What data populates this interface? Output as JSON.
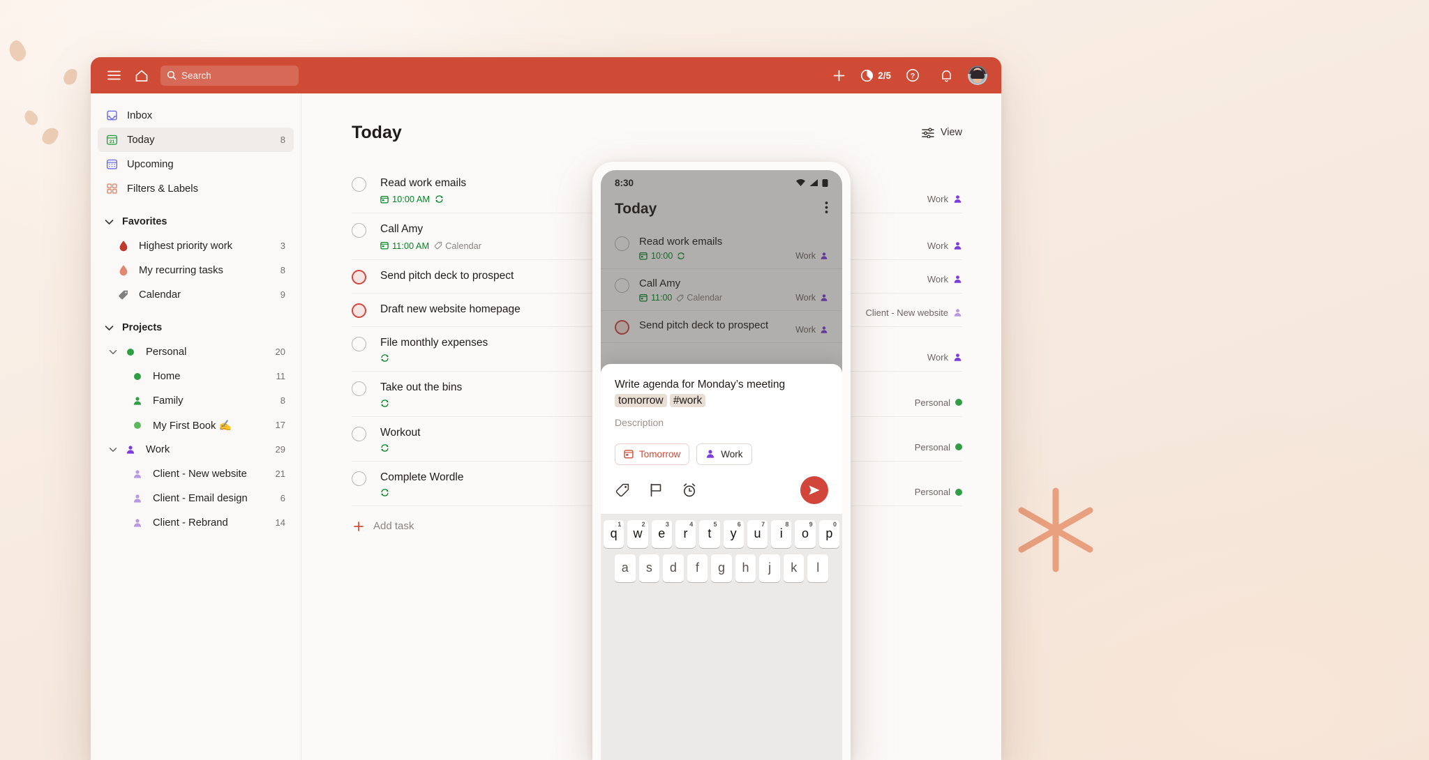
{
  "topbar": {
    "menu_icon": "hamburger-menu-icon",
    "home_icon": "home-icon",
    "search_icon": "search-icon",
    "search_placeholder": "Search",
    "add_icon": "plus-icon",
    "karma_icon": "productivity-pie-icon",
    "karma_value": "2/5",
    "help_icon": "question-mark-icon",
    "bell_icon": "notification-bell-icon",
    "avatar_icon": "user-avatar",
    "background_color": "#cf4b35"
  },
  "sidebar": {
    "nav": [
      {
        "label": "Inbox",
        "icon": "inbox-icon",
        "count": "",
        "active": false
      },
      {
        "label": "Today",
        "icon": "calendar-21-icon",
        "count": "8",
        "active": true
      },
      {
        "label": "Upcoming",
        "icon": "calendar-grid-icon",
        "count": "",
        "active": false
      },
      {
        "label": "Filters & Labels",
        "icon": "filters-labels-icon",
        "count": "",
        "active": false
      }
    ],
    "favorites": {
      "title": "Favorites",
      "items": [
        {
          "label": "Highest priority work",
          "icon": "flame-icon",
          "color": "#c0392b",
          "count": "3"
        },
        {
          "label": "My recurring tasks",
          "icon": "flame-icon",
          "color": "#e08870",
          "count": "8"
        },
        {
          "label": "Calendar",
          "icon": "tag-icon",
          "color": "#808080",
          "count": "9"
        }
      ]
    },
    "projects": {
      "title": "Projects",
      "items": [
        {
          "label": "Personal",
          "icon": "dot-icon",
          "color": "#2f9e44",
          "count": "20",
          "indent": 0,
          "caret": true
        },
        {
          "label": "Home",
          "icon": "dot-icon",
          "color": "#2f9e44",
          "count": "11",
          "indent": 1,
          "caret": false
        },
        {
          "label": "Family",
          "icon": "person-icon",
          "color": "#2f9e44",
          "count": "8",
          "indent": 1,
          "caret": false
        },
        {
          "label": "My First Book ✍️",
          "icon": "dot-icon",
          "color": "#5cb85c",
          "count": "17",
          "indent": 1,
          "caret": false
        },
        {
          "label": "Work",
          "icon": "person-icon",
          "color": "#7a3ee0",
          "count": "29",
          "indent": 0,
          "caret": true
        },
        {
          "label": "Client - New website",
          "icon": "person-icon",
          "color": "#b89ae0",
          "count": "21",
          "indent": 2,
          "caret": false
        },
        {
          "label": "Client - Email design",
          "icon": "person-icon",
          "color": "#b89ae0",
          "count": "6",
          "indent": 2,
          "caret": false
        },
        {
          "label": "Client - Rebrand",
          "icon": "person-icon",
          "color": "#b89ae0",
          "count": "14",
          "indent": 2,
          "caret": false
        }
      ]
    }
  },
  "main": {
    "page_title": "Today",
    "view_button": {
      "label": "View",
      "icon": "sliders-icon"
    },
    "add_task": {
      "label": "Add task",
      "icon": "plus-icon"
    },
    "tasks": [
      {
        "title": "Read work emails",
        "date": "10:00 AM",
        "recurring": true,
        "label": "",
        "project": "Work",
        "project_icon": "person-icon",
        "project_color": "#7a3ee0",
        "priority": 0
      },
      {
        "title": "Call Amy",
        "date": "11:00 AM",
        "recurring": false,
        "label": "Calendar",
        "project": "Work",
        "project_icon": "person-icon",
        "project_color": "#7a3ee0",
        "priority": 0
      },
      {
        "title": "Send pitch deck to prospect",
        "date": "",
        "recurring": false,
        "label": "",
        "project": "Work",
        "project_icon": "person-icon",
        "project_color": "#7a3ee0",
        "priority": 1
      },
      {
        "title": "Draft new website homepage",
        "date": "",
        "recurring": false,
        "label": "",
        "project": "Client - New website",
        "project_icon": "person-icon",
        "project_color": "#b89ae0",
        "priority": 1
      },
      {
        "title": "File monthly expenses",
        "date": "",
        "recurring": true,
        "label": "",
        "project": "Work",
        "project_icon": "person-icon",
        "project_color": "#7a3ee0",
        "priority": 0
      },
      {
        "title": "Take out the bins",
        "date": "",
        "recurring": true,
        "label": "",
        "project": "Personal",
        "project_icon": "dot-icon",
        "project_color": "#2f9e44",
        "priority": 0
      },
      {
        "title": "Workout",
        "date": "",
        "recurring": true,
        "label": "",
        "project": "Personal",
        "project_icon": "dot-icon",
        "project_color": "#2f9e44",
        "priority": 0
      },
      {
        "title": "Complete Wordle",
        "date": "",
        "recurring": true,
        "label": "",
        "project": "Personal",
        "project_icon": "dot-icon",
        "project_color": "#2f9e44",
        "priority": 0
      }
    ]
  },
  "phone": {
    "status_time": "8:30",
    "status_icons": [
      "wifi-icon",
      "cellular-signal-icon",
      "battery-icon"
    ],
    "title": "Today",
    "kebab_icon": "more-options-icon",
    "tasks": [
      {
        "title": "Read work emails",
        "date": "10:00",
        "recurring": true,
        "label": "",
        "project": "Work",
        "priority": 0
      },
      {
        "title": "Call Amy",
        "date": "11:00",
        "recurring": false,
        "label": "Calendar",
        "project": "Work",
        "priority": 0
      },
      {
        "title": "Send pitch deck to prospect",
        "date": "",
        "recurring": false,
        "label": "",
        "project": "Work",
        "priority": 1
      }
    ],
    "quick_add": {
      "title_prefix": "Write agenda for Monday’s meeting",
      "token_date": "tomorrow",
      "token_project": "#work",
      "description_placeholder": "Description",
      "chips": [
        {
          "label": "Tomorrow",
          "icon": "calendar-icon",
          "kind": "date"
        },
        {
          "label": "Work",
          "icon": "person-icon",
          "kind": "proj"
        }
      ],
      "actions": [
        "label-tag-icon",
        "priority-flag-icon",
        "reminder-alarm-icon"
      ],
      "send_icon": "send-arrow-icon",
      "send_color": "#d1453b"
    },
    "keyboard": {
      "row1": [
        {
          "key": "q",
          "num": "1"
        },
        {
          "key": "w",
          "num": "2"
        },
        {
          "key": "e",
          "num": "3"
        },
        {
          "key": "r",
          "num": "4"
        },
        {
          "key": "t",
          "num": "5"
        },
        {
          "key": "y",
          "num": "6"
        },
        {
          "key": "u",
          "num": "7"
        },
        {
          "key": "i",
          "num": "8"
        },
        {
          "key": "o",
          "num": "9"
        },
        {
          "key": "p",
          "num": "0"
        }
      ],
      "row2": [
        {
          "key": "a",
          "num": ""
        },
        {
          "key": "s",
          "num": ""
        },
        {
          "key": "d",
          "num": ""
        },
        {
          "key": "f",
          "num": ""
        },
        {
          "key": "g",
          "num": ""
        },
        {
          "key": "h",
          "num": ""
        },
        {
          "key": "j",
          "num": ""
        },
        {
          "key": "k",
          "num": ""
        },
        {
          "key": "l",
          "num": ""
        }
      ]
    }
  }
}
